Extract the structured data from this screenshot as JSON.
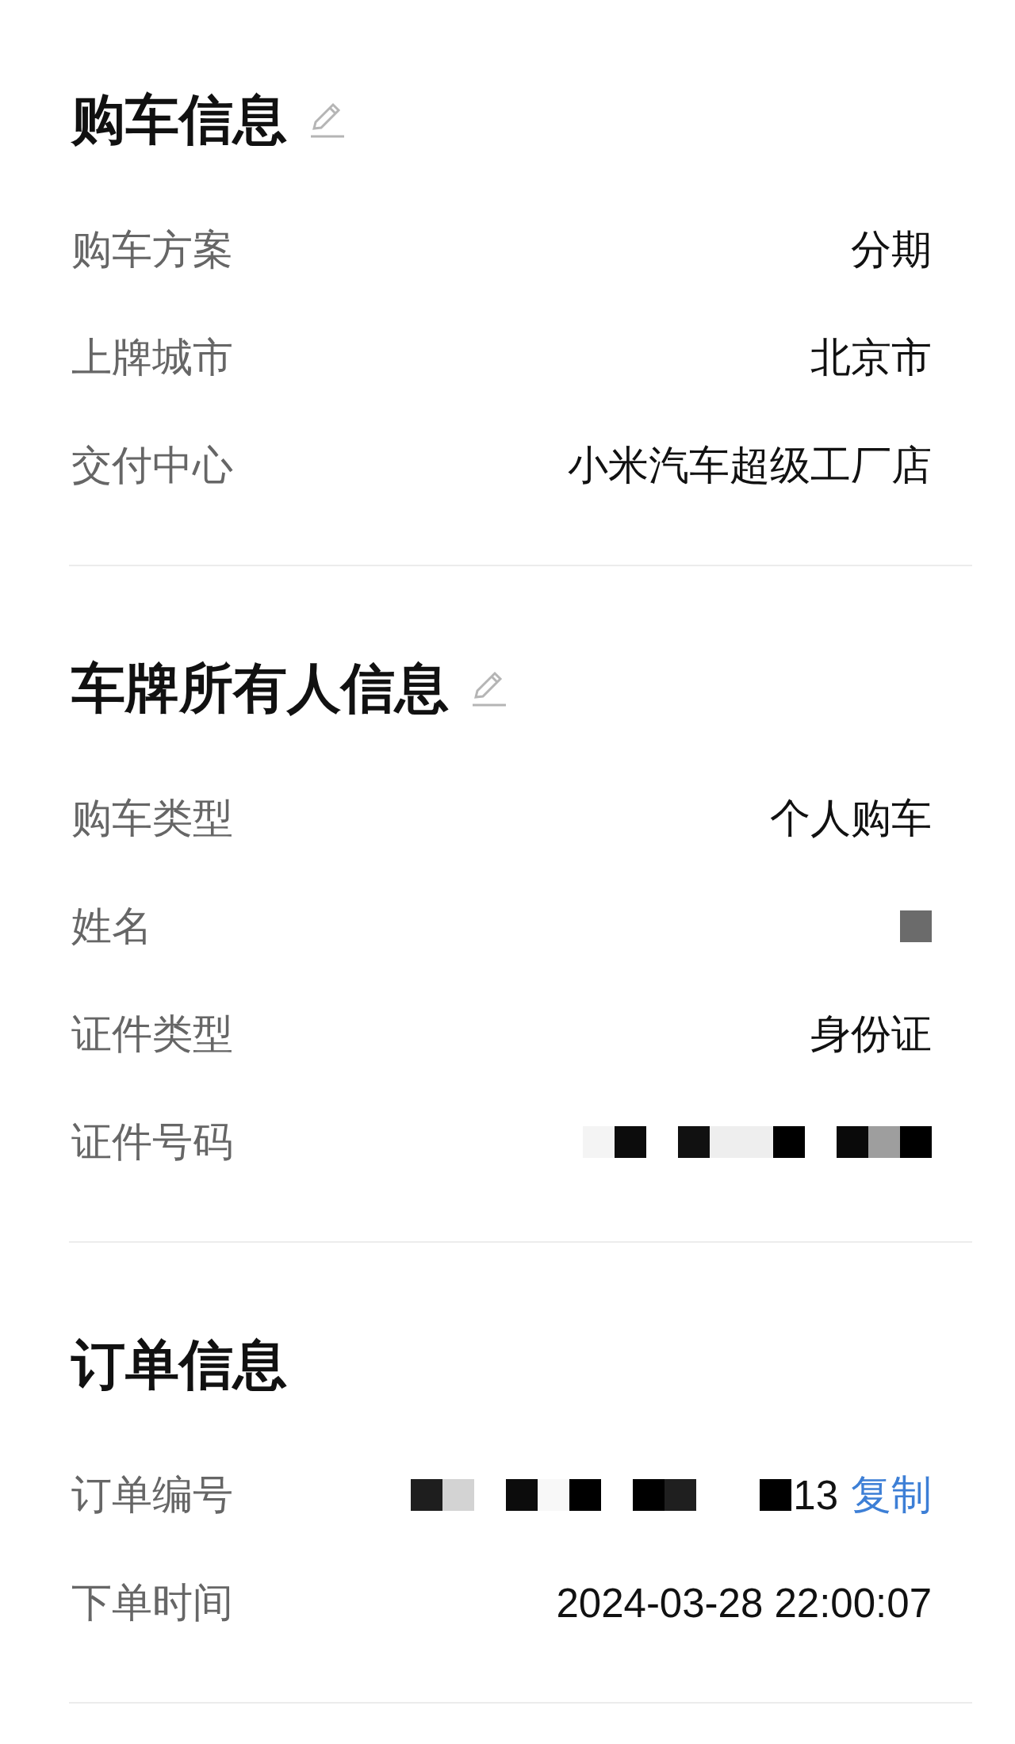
{
  "sections": [
    {
      "title": "购车信息",
      "editable": true,
      "rows": [
        {
          "label": "购车方案",
          "kind": "text",
          "value": "分期"
        },
        {
          "label": "上牌城市",
          "kind": "text",
          "value": "北京市"
        },
        {
          "label": "交付中心",
          "kind": "text",
          "value": "小米汽车超级工厂店"
        }
      ]
    },
    {
      "title": "车牌所有人信息",
      "editable": true,
      "rows": [
        {
          "label": "购车类型",
          "kind": "text",
          "value": "个人购车"
        },
        {
          "label": "姓名",
          "kind": "redacted"
        },
        {
          "label": "证件类型",
          "kind": "text",
          "value": "身份证"
        },
        {
          "label": "证件号码",
          "kind": "redacted"
        }
      ]
    },
    {
      "title": "订单信息",
      "editable": false,
      "rows": [
        {
          "label": "订单编号",
          "kind": "redacted",
          "value": "13",
          "action": "复制"
        },
        {
          "label": "下单时间",
          "kind": "text",
          "value": "2024-03-28 22:00:07"
        }
      ]
    }
  ]
}
